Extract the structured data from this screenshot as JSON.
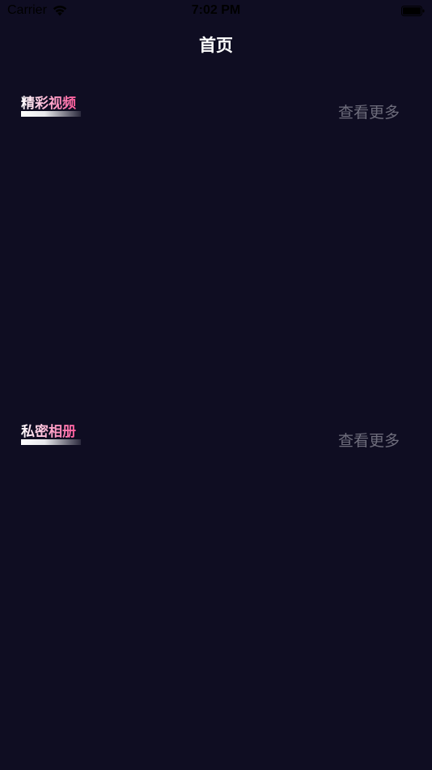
{
  "status_bar": {
    "carrier": "Carrier",
    "time": "7:02 PM",
    "icons": [
      "wifi-icon",
      "battery-icon"
    ]
  },
  "nav": {
    "title": "首页"
  },
  "sections": [
    {
      "title": "精彩视频",
      "more_label": "查看更多"
    },
    {
      "title": "私密相册",
      "more_label": "查看更多"
    }
  ],
  "colors": {
    "background": "#0f0d22",
    "section_title_accent": "#ff5a9c",
    "more_link": "#6e6d7c",
    "nav_title": "#ffffff"
  }
}
